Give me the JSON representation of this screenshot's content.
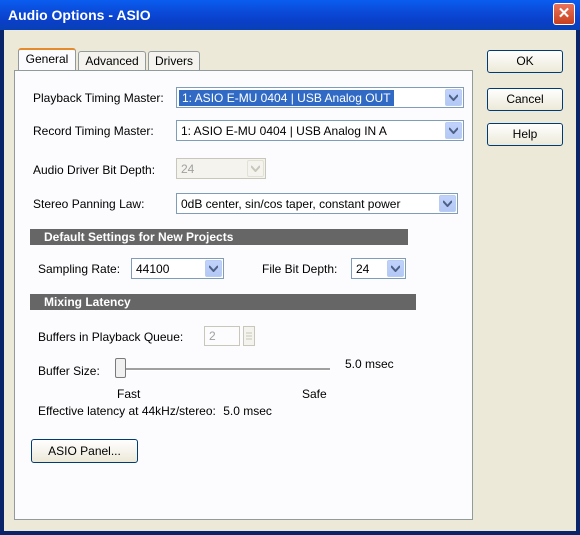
{
  "window": {
    "title": "Audio Options - ASIO",
    "close_glyph": "✕"
  },
  "tabs": [
    {
      "label": "General",
      "active": true
    },
    {
      "label": "Advanced",
      "active": false
    },
    {
      "label": "Drivers",
      "active": false
    }
  ],
  "buttons": {
    "ok": "OK",
    "cancel": "Cancel",
    "help": "Help",
    "asio_panel": "ASIO Panel..."
  },
  "general": {
    "playback_timing_master": {
      "label": "Playback Timing Master:",
      "value": "1: ASIO E-MU 0404 | USB Analog OUT"
    },
    "record_timing_master": {
      "label": "Record Timing Master:",
      "value": "1: ASIO E-MU 0404 | USB Analog IN A"
    },
    "bit_depth": {
      "label": "Audio Driver Bit Depth:",
      "value": "24",
      "disabled": true
    },
    "panning_law": {
      "label": "Stereo Panning Law:",
      "value": "0dB center, sin/cos taper, constant power"
    }
  },
  "defaults": {
    "heading": "Default Settings for New Projects",
    "sampling_rate": {
      "label": "Sampling Rate:",
      "value": "44100"
    },
    "file_bit_depth": {
      "label": "File Bit Depth:",
      "value": "24"
    }
  },
  "latency": {
    "heading": "Mixing Latency",
    "buffers_label": "Buffers in Playback Queue:",
    "buffers_value": "2",
    "buffer_size_label": "Buffer Size:",
    "buffer_size_value": "5.0 msec",
    "slider_position": 0.0,
    "fast_label": "Fast",
    "safe_label": "Safe",
    "effective_label": "Effective latency at 44kHz/stereo:",
    "effective_value": "5.0 msec"
  },
  "colors": {
    "titlebar": "#0a4ad8",
    "selection": "#316ac5",
    "section_bar": "#666666",
    "dialog_bg": "#ece9d8"
  }
}
